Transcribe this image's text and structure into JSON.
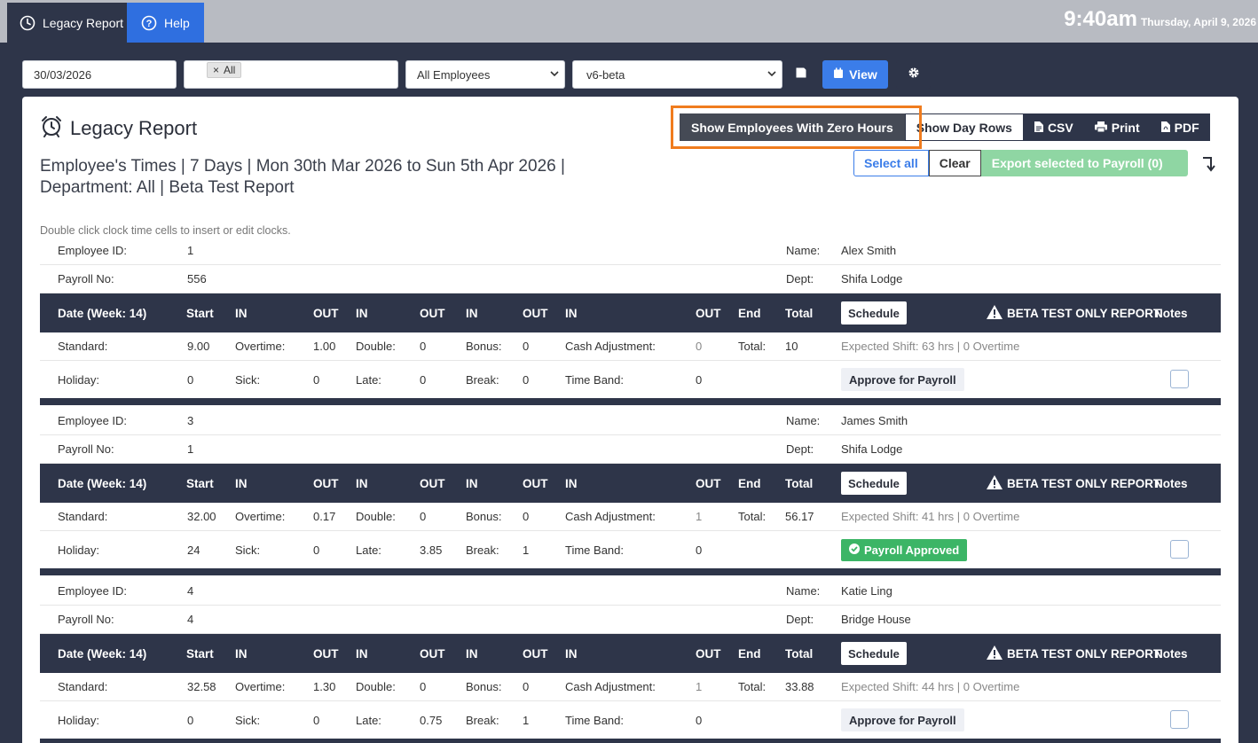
{
  "tabs": [
    {
      "label": "Legacy Report",
      "icon": "clock-icon"
    },
    {
      "label": "Help",
      "icon": "help-circle-icon"
    }
  ],
  "clock": {
    "time": "9:40am",
    "date": "Thursday, April 9, 2026"
  },
  "filters": {
    "date": "30/03/2026",
    "tag": "All",
    "employees": "All Employees",
    "version": "v6-beta",
    "view_label": "View"
  },
  "report": {
    "title": "Legacy Report",
    "subtitle": "Employee's Times | 7 Days | Mon 30th Mar 2026 to Sun 5th Apr 2026 | Department: All | Beta Test Report",
    "hint": "Double click clock time cells to insert or edit clocks."
  },
  "toolbar": {
    "zero_hours": "Show Employees With Zero Hours",
    "day_rows": "Show Day Rows",
    "csv": "CSV",
    "print": "Print",
    "pdf": "PDF",
    "select_all": "Select all",
    "clear": "Clear",
    "export": "Export selected to Payroll (0)"
  },
  "labels": {
    "employee_id": "Employee ID:",
    "payroll_no": "Payroll No:",
    "name": "Name:",
    "dept": "Dept:",
    "date_week": "Date (Week: 14)",
    "start": "Start",
    "in": "IN",
    "out": "OUT",
    "end": "End",
    "total": "Total",
    "schedule": "Schedule",
    "beta": "BETA TEST ONLY REPORT",
    "notes": "Notes",
    "standard": "Standard:",
    "overtime": "Overtime:",
    "double": "Double:",
    "bonus": "Bonus:",
    "cash_adj": "Cash Adjustment:",
    "total_colon": "Total:",
    "holiday": "Holiday:",
    "sick": "Sick:",
    "late": "Late:",
    "break": "Break:",
    "time_band": "Time Band:",
    "approve": "Approve for Payroll",
    "approved": "Payroll Approved"
  },
  "employees": [
    {
      "id": "1",
      "payroll": "556",
      "name": "Alex Smith",
      "dept": "Shifa Lodge",
      "standard": "9.00",
      "overtime": "1.00",
      "double": "0",
      "bonus": "0",
      "cash": "0",
      "total": "10",
      "expected": "Expected Shift: 63 hrs | 0 Overtime",
      "holiday": "0",
      "sick": "0",
      "late": "0",
      "break": "0",
      "time_band": "0",
      "approved": false
    },
    {
      "id": "3",
      "payroll": "1",
      "name": "James Smith",
      "dept": "Shifa Lodge",
      "standard": "32.00",
      "overtime": "0.17",
      "double": "0",
      "bonus": "0",
      "cash": "1",
      "total": "56.17",
      "expected": "Expected Shift: 41 hrs | 0 Overtime",
      "holiday": "24",
      "sick": "0",
      "late": "3.85",
      "break": "1",
      "time_band": "0",
      "approved": true
    },
    {
      "id": "4",
      "payroll": "4",
      "name": "Katie Ling",
      "dept": "Bridge House",
      "standard": "32.58",
      "overtime": "1.30",
      "double": "0",
      "bonus": "0",
      "cash": "1",
      "total": "33.88",
      "expected": "Expected Shift: 44 hrs | 0 Overtime",
      "holiday": "0",
      "sick": "0",
      "late": "0.75",
      "break": "1",
      "time_band": "0",
      "approved": false
    }
  ]
}
